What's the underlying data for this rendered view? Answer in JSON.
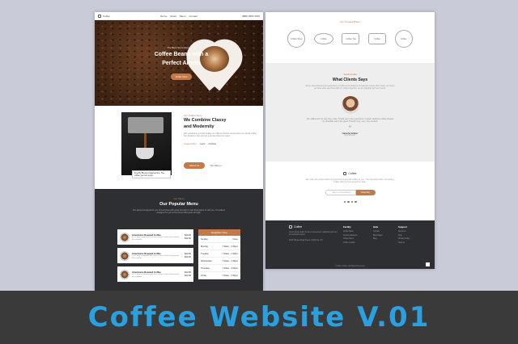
{
  "banner_title": "Coffee Website V.01",
  "left": {
    "nav": {
      "brand": "Coffee",
      "menu": [
        "Home",
        "About",
        "Menu",
        "Contact"
      ],
      "phone": "(888) 3809 3620"
    },
    "hero": {
      "tagline": "The Best Sip in Every Cup",
      "headline_1": "Coffee Beans with a",
      "headline_2": "Perfect Aroma",
      "button": "Order Now"
    },
    "about": {
      "subtitle": "Our Coffee Story",
      "heading_1": "We Combine Classy",
      "heading_2": "and Modernity",
      "para": "We guarantee you that quality our clients choose comes from our whole coffee bar. Explore more and let us know what you need.",
      "list": [
        "Cappuccino",
        "Latte",
        "Robbie"
      ],
      "caption": "Freshly Brewed Cappuccino. The coffee you can enjoy.",
      "button": "About Us",
      "link": "Our Menu  ›"
    },
    "menu": {
      "subtitle": "Our Menu",
      "heading": "Our Popular Menu",
      "para": "Our places designed for you to feel home with great strength to start theat place to visit you. Our places designed for you to feel home with great strength.",
      "items": [
        {
          "name": "Americano Roasted Coffee",
          "desc": "It is a long established fact that a reader will be distracted by the readable",
          "price": "$10.00",
          "price2": "$12.00"
        },
        {
          "name": "Americano Roasted Coffee",
          "desc": "It is a long established fact that a reader will be distracted by the readable",
          "price": "$10.00",
          "price2": "$12.00"
        },
        {
          "name": "Americano Roasted Coffee",
          "desc": "It is a long established fact that a reader will be distracted by the readable",
          "price": "$10.00",
          "price2": "$12.00"
        }
      ],
      "hours_title": "Delightful Time",
      "hours": [
        {
          "day": "Sunday",
          "time": "Close"
        },
        {
          "day": "Monday",
          "time": "7.30am - 4.30pm"
        },
        {
          "day": "Tuesday",
          "time": "7.30am - 4.30pm"
        },
        {
          "day": "Wednesday",
          "time": "7.30am - 4.30pm"
        },
        {
          "day": "Thursday",
          "time": "7.30am - 4.30pm"
        },
        {
          "day": "Friday",
          "time": "7.30am - 4.30pm"
        }
      ]
    }
  },
  "right": {
    "brands": {
      "subtitle": "Our Trusted Brand",
      "logos": [
        "Coffee Shop",
        "Coffee",
        "Coffee Tea",
        "Coffee",
        "Coffee"
      ]
    },
    "testimonials": {
      "subtitle": "Testimonials",
      "heading": "What Clients Says",
      "para": "Some researchers and researchers at coffee and pleasure of business career. But it does not mean we have done anything with our coffee together, we are together with our clients.",
      "quote": "Our coffee and the way they make. Thank you to the experience of good, delicious coffee created by 'abdullah' and more good. Thanks! very, very, very excited!",
      "name": "Natasha Walker",
      "role": "Guy Marketer"
    },
    "newsletter": {
      "brand": "Coffee",
      "para": "We make the perfect place for great food and great coffee for you. Your favourite place, everything. Coffee with the best of good in town.",
      "placeholder": "Enter email address",
      "button": "Subscribe"
    },
    "footer": {
      "brand": "Coffee",
      "about": "Lorem ipsum dolor sit amet consectetur, adipiscing elit sed do eiusmod tempor.",
      "address": "1000 Holmer Road Street, California, US",
      "cols": [
        {
          "title": "Facility",
          "items": [
            "Coffee Bean",
            "Cooking Recipes",
            "Coffee Menu",
            "Coffee Quality"
          ]
        },
        {
          "title": "Help",
          "items": [
            "Contact",
            "Blog Pages",
            "Blog"
          ]
        },
        {
          "title": "Support",
          "items": [
            "About Us",
            "Help",
            "Privacy Policy",
            "Help Us"
          ]
        }
      ],
      "copyright": "© 2021 Coffee. All Rights Reserved."
    }
  }
}
